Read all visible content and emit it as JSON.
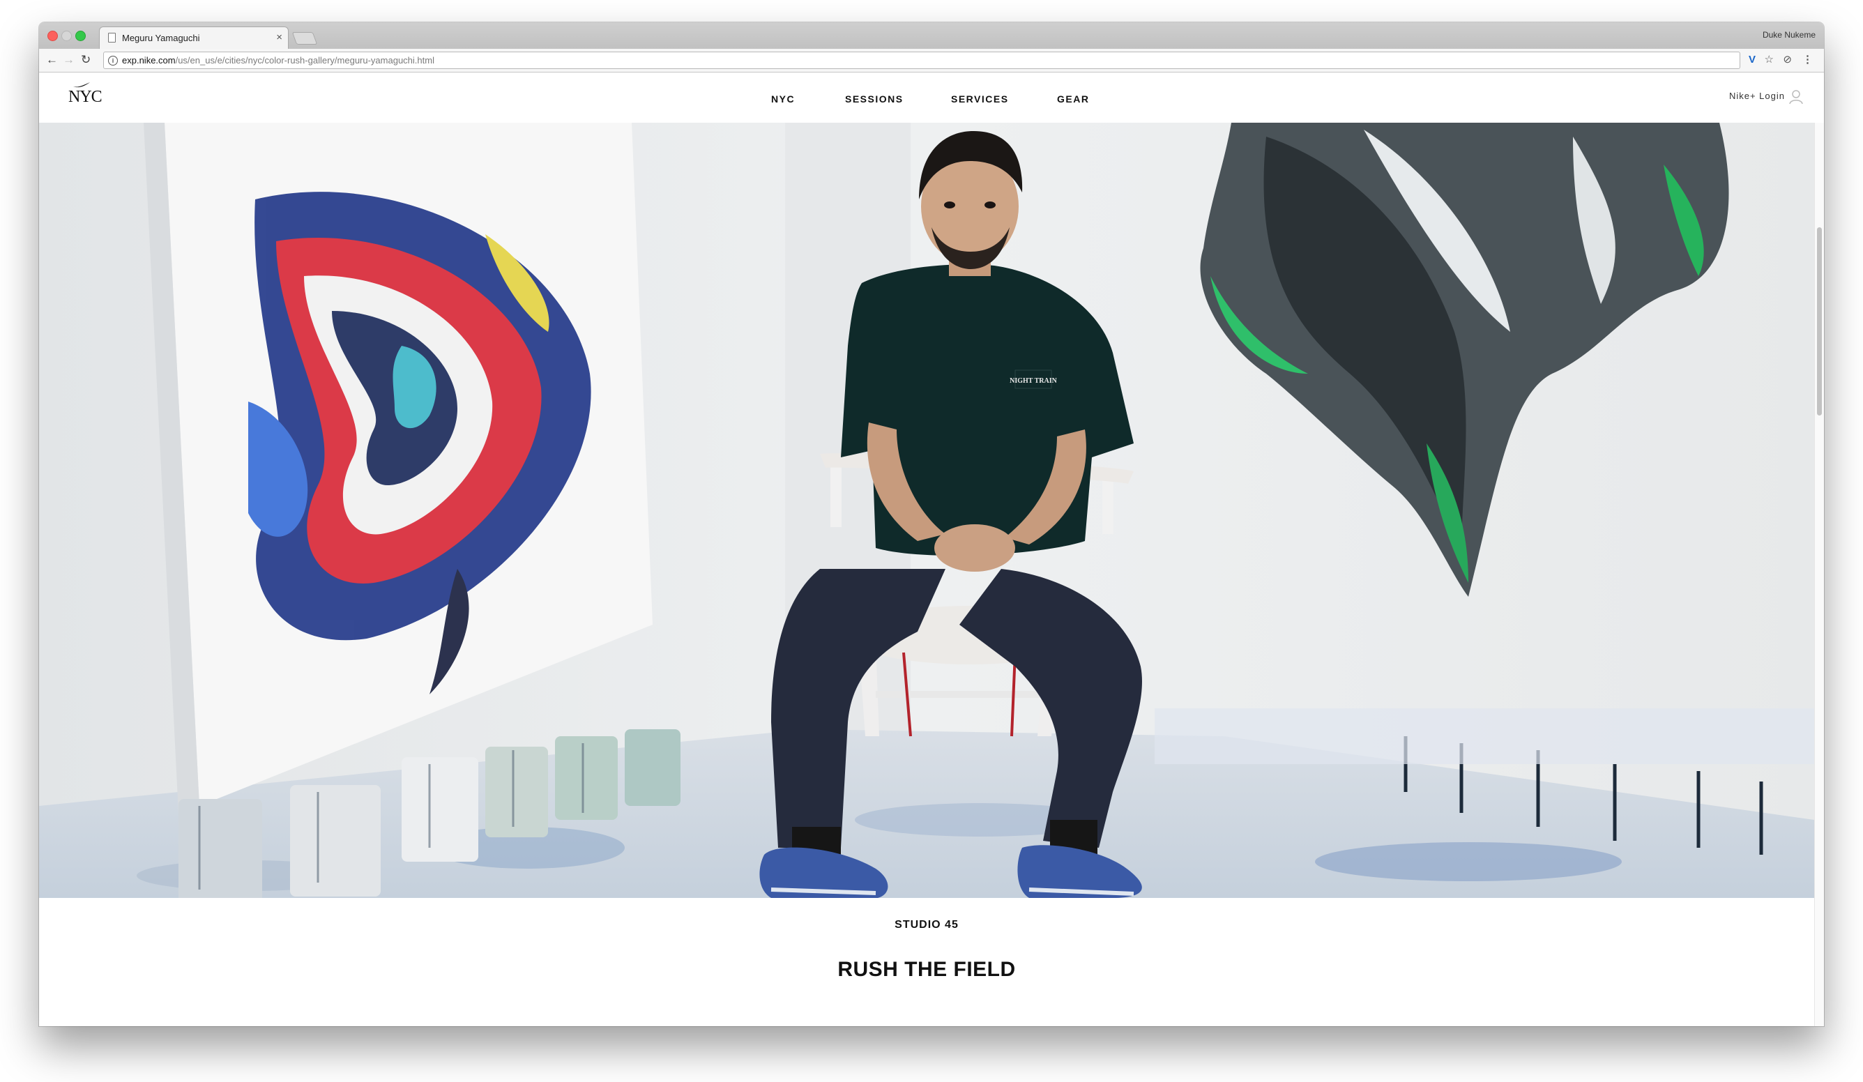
{
  "browser": {
    "tab_title": "Meguru Yamaguchi",
    "tab_close": "×",
    "profile_name": "Duke Nukeme",
    "url_host": "exp.nike.com",
    "url_path": "/us/en_us/e/cities/nyc/color-rush-gallery/meguru-yamaguchi.html",
    "back": "←",
    "forward": "→",
    "reload": "↻",
    "menu": "⋮"
  },
  "site": {
    "logo_text": "NYC",
    "nav": [
      "NYC",
      "SESSIONS",
      "SERVICES",
      "GEAR"
    ],
    "login": "Nike+ Login"
  },
  "hero": {
    "shirt_text": "NIGHT TRAIN"
  },
  "article": {
    "kicker": "STUDIO 45",
    "headline": "RUSH THE FIELD"
  },
  "colors": {
    "accent": "#111111",
    "swoosh": "#111111"
  }
}
